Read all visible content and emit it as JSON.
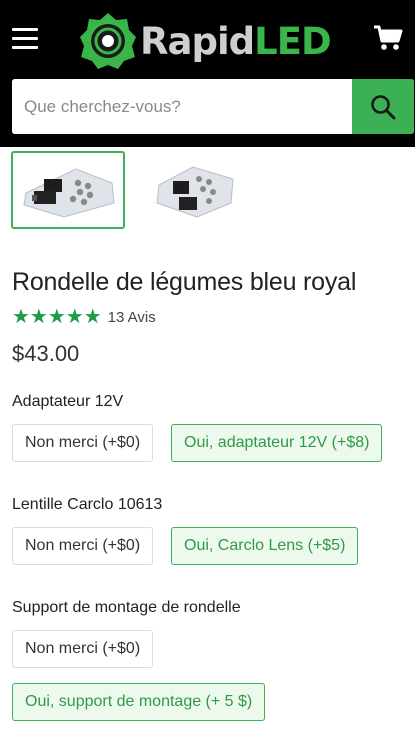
{
  "header": {
    "logo": {
      "rapid": "Rapid",
      "led": "LED"
    },
    "icons": {
      "menu": "hamburger-menu-icon",
      "cart": "shopping-cart-icon",
      "search": "magnifier-icon"
    }
  },
  "search": {
    "placeholder": "Que cherchez-vous?"
  },
  "product": {
    "title": "Rondelle de légumes bleu royal",
    "stars": "★★★★★",
    "rating": 5,
    "reviews": "13 Avis",
    "price": "$43.00"
  },
  "options": [
    {
      "label": "Adaptateur 12V",
      "choices": [
        "Non merci (+$0)",
        "Oui, adaptateur 12V (+$8)"
      ],
      "selected": 1
    },
    {
      "label": "Lentille Carclo 10613",
      "choices": [
        "Non merci (+$0)",
        "Oui, Carclo Lens (+$5)"
      ],
      "selected": 1
    },
    {
      "label": "Support de montage de rondelle",
      "choices": [
        "Non merci (+$0)",
        "Oui, support de montage (+ 5 $)"
      ],
      "selected": 1
    }
  ],
  "colors": {
    "accent": "#3cb054",
    "header_bg": "#000000",
    "star": "#1f9a45",
    "selected_bg": "#eef9ee"
  }
}
